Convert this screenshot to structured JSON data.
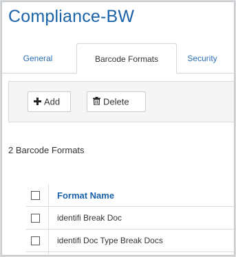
{
  "app": {
    "title": "Compliance-BW"
  },
  "tabs": [
    {
      "label": "General",
      "active": false
    },
    {
      "label": "Barcode Formats",
      "active": true
    },
    {
      "label": "Security",
      "active": false
    }
  ],
  "toolbar": {
    "add_label": "Add",
    "add_icon": "plus-icon",
    "delete_label": "Delete",
    "delete_icon": "trash-icon"
  },
  "summary": {
    "count_text": "2 Barcode Formats"
  },
  "table": {
    "columns": [
      "Format Name"
    ],
    "rows": [
      {
        "format_name": "identifi Break Doc"
      },
      {
        "format_name": "identifi Doc Type Break Docs"
      }
    ]
  },
  "colors": {
    "accent": "#1a62a8",
    "text": "#333333",
    "border": "#d5d5d5"
  }
}
